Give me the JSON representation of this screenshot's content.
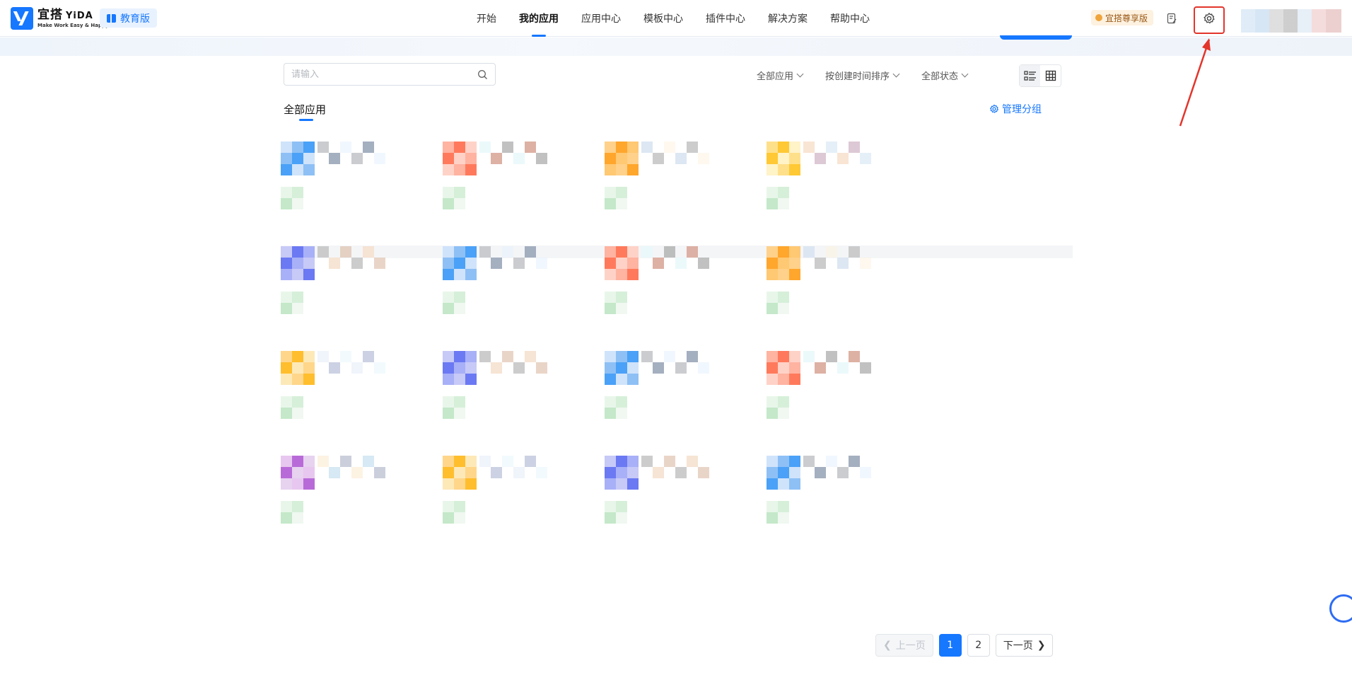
{
  "header": {
    "logo_main": "宜搭",
    "logo_yida": "YiDA",
    "logo_sub": "Make Work Easy & Happy",
    "edition": "教育版",
    "nav": [
      "开始",
      "我的应用",
      "应用中心",
      "模板中心",
      "插件中心",
      "解决方案",
      "帮助中心"
    ],
    "active_nav": "我的应用",
    "vip_label": "宜搭尊享版"
  },
  "toolbar": {
    "search_placeholder": "请输入",
    "filter_apps": "全部应用",
    "filter_sort": "按创建时间排序",
    "filter_status": "全部状态"
  },
  "section": {
    "title": "全部应用",
    "manage_label": "管理分组"
  },
  "pagination": {
    "prev": "上一页",
    "pages": [
      "1",
      "2"
    ],
    "current": "1",
    "next": "下一页"
  },
  "colors": {
    "accent": "#1677ff",
    "highlight": "#e3352b"
  }
}
